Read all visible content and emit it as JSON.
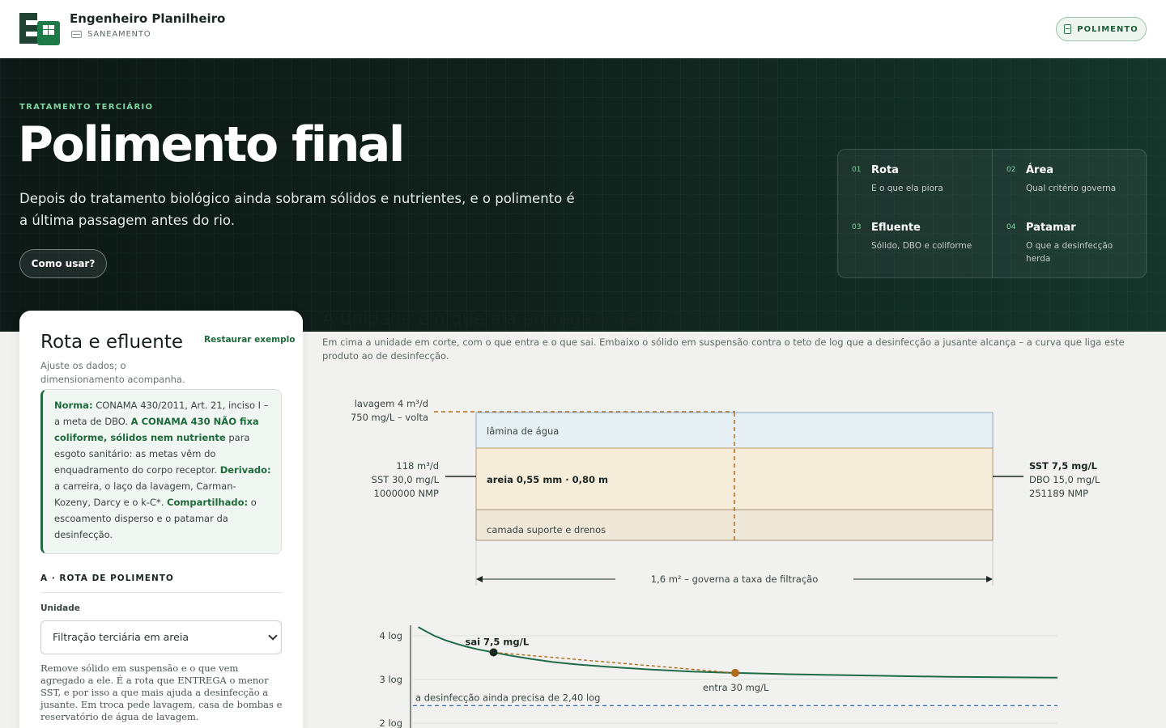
{
  "brand": {
    "logo_text": "EP",
    "title": "Engenheiro Planilheiro",
    "subtitle": "SANEAMENTO"
  },
  "header": {
    "module_badge": "POLIMENTO"
  },
  "hero": {
    "eyebrow": "TRATAMENTO TERCIÁRIO",
    "title": "Polimento final",
    "lead": "Depois do tratamento biológico ainda sobram sólidos e nutrientes, e o polimento é a última passagem antes do rio.",
    "how_button": "Como usar?",
    "steps": [
      {
        "num": "01",
        "title": "Rota",
        "desc": "E o que ela piora"
      },
      {
        "num": "02",
        "title": "Área",
        "desc": "Qual critério governa"
      },
      {
        "num": "03",
        "title": "Efluente",
        "desc": "Sólido, DBO e coliforme"
      },
      {
        "num": "04",
        "title": "Patamar",
        "desc": "O que a desinfecção herda"
      }
    ]
  },
  "sidebar": {
    "title": "Rota e efluente",
    "restore_link": "Restaurar exemplo",
    "hint": "Ajuste os dados; o dimensionamento acompanha.",
    "norm": {
      "label1": "Norma:",
      "text1": " CONAMA 430/2011, Art. 21, inciso I – a meta de DBO. ",
      "bold2": "A CONAMA 430 NÃO fixa coliforme, sólidos nem nutriente",
      "text2": " para esgoto sanitário: as metas vêm do enquadramento do corpo receptor. ",
      "label3": "Derivado:",
      "text3": " a carreira, o laço da lavagem, Carman-Kozeny, Darcy e o k-C*. ",
      "label4": "Compartilhado:",
      "text4": " o escoamento disperso e o patamar da desinfecção."
    },
    "section_a": "A · ROTA DE POLIMENTO",
    "unit_label": "Unidade",
    "unit_value": "Filtração terciária em areia",
    "unit_desc": "Remove sólido em suspensão e o que vem agregado a ele. É a rota que ENTREGA o menor SST, e por isso a que mais ajuda a desinfecção a jusante. Em troca pede lavagem, casa de bombas e reservatório de água de lavagem."
  },
  "main": {
    "title": "A unidade e o que ela entrega à desinfecção",
    "caption": "Em cima a unidade em corte, com o que entra e o que sai. Embaixo o sólido em suspensão contra o teto de log que a desinfecção a jusante alcança – a curva que liga este produto ao de desinfecção."
  },
  "section_diagram": {
    "backwash_line1": "lavagem 4 m³/d",
    "backwash_line2": "750 mg/L – volta",
    "inflow": [
      "118 m³/d",
      "SST 30,0 mg/L",
      "1000000 NMP"
    ],
    "outflow": [
      "SST 7,5 mg/L",
      "DBO 15,0 mg/L",
      "251189 NMP"
    ],
    "layer_water": "lâmina de água",
    "layer_sand": "areia 0,55 mm · 0,80 m",
    "layer_support": "camada suporte e drenos",
    "area_label": "1,6 m² – governa a taxa de filtração"
  },
  "chart_data": {
    "type": "line",
    "y_ticks": [
      "4 log",
      "3 log",
      "2 log"
    ],
    "ylim": [
      2,
      4.3
    ],
    "xlim": [
      0,
      60
    ],
    "xlabel": "",
    "ylabel": "",
    "series": [
      {
        "x": [
          0.5,
          1,
          2,
          3,
          4,
          5,
          6,
          7.5,
          9,
          11,
          13,
          15,
          18,
          22,
          26,
          30,
          35,
          40,
          45,
          50,
          55,
          60
        ],
        "y": [
          4.2,
          4.13,
          4.0,
          3.9,
          3.82,
          3.75,
          3.69,
          3.62,
          3.55,
          3.47,
          3.4,
          3.35,
          3.29,
          3.23,
          3.18,
          3.15,
          3.12,
          3.1,
          3.08,
          3.06,
          3.05,
          3.04
        ],
        "color": "#1f6b48"
      }
    ],
    "points": [
      {
        "label": "sai 7,5 mg/L",
        "x": 7.5,
        "y": 3.62,
        "color": "#1c2620"
      },
      {
        "label": "entra 30 mg/L",
        "x": 30,
        "y": 3.15,
        "color": "#b36a1b"
      }
    ],
    "threshold": {
      "label": "a desinfecção ainda precisa de 2,40 log",
      "y": 2.4,
      "color": "#3b6aa8"
    },
    "grid": true
  }
}
